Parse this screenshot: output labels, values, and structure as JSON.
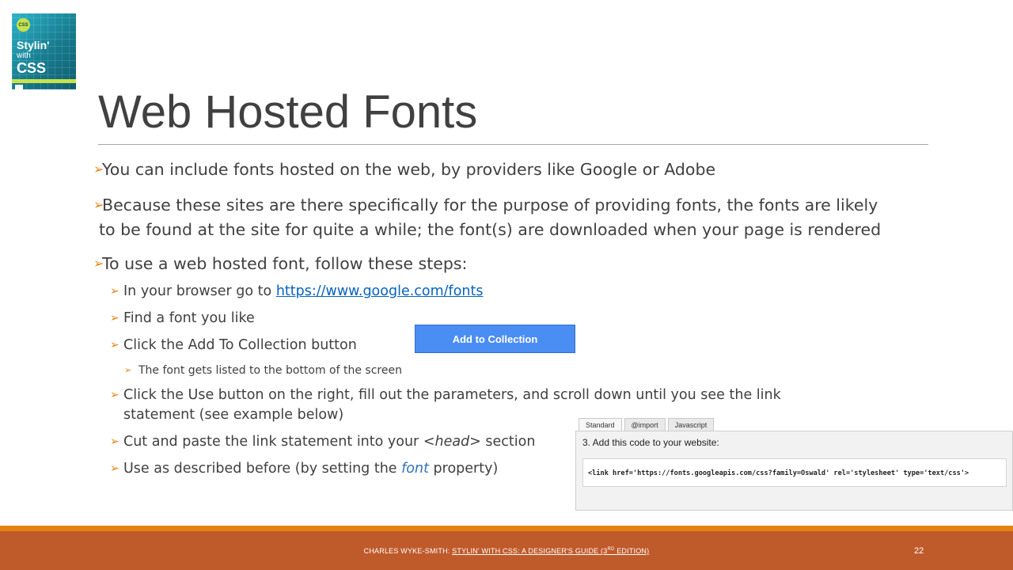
{
  "book": {
    "badge": "CSS",
    "title_line1": "Stylin'",
    "title_line2": "with",
    "title_line3": "CSS"
  },
  "slide": {
    "title": "Web Hosted Fonts",
    "bullets": [
      {
        "text": "You can include fonts hosted on the web, by providers like Google or Adobe"
      },
      {
        "line1": "Because these sites are there specifically for the purpose of providing fonts, the fonts are likely",
        "line2": "to be found at the site for quite a while; the font(s) are downloaded when your page is rendered"
      },
      {
        "text": "To use a web hosted font, follow these steps:"
      }
    ],
    "steps": {
      "browser_prefix": "In your browser go to ",
      "browser_link": "https://www.google.com/fonts",
      "find_font": "Find a font you like",
      "click_add": "Click the Add To Collection button",
      "listed_note": "The font gets listed to the bottom of the screen",
      "use_line1": "Click the Use button on the right, fill out the parameters, and scroll down until you see the link",
      "use_line2": "statement (see example below)",
      "cut_prefix": "Cut and paste the link statement into your ",
      "cut_tag": "<head>",
      "cut_suffix": " section",
      "use_prefix": "Use  as described before (by setting the ",
      "use_em": "font",
      "use_suffix": " property)"
    },
    "add_button_label": "Add to Collection"
  },
  "embed": {
    "tabs": [
      "Standard",
      "@import",
      "Javascript"
    ],
    "heading": "3. Add this code to your website:",
    "code": "<link href='https://fonts.googleapis.com/css?family=Oswald' rel='stylesheet' type='text/css'>"
  },
  "footer": {
    "author": "CHARLES WYKE-SMITH: ",
    "book_title": "STYLIN' WITH CSS: A DESIGNER'S GUIDE (3",
    "edition_sup": "RD",
    "edition_suffix": " EDITION)",
    "page_number": "22"
  },
  "colors": {
    "accent_orange": "#e48312",
    "footer_rust": "#bf5a2b",
    "button_blue": "#4a8df3",
    "link_blue": "#0563c1"
  }
}
